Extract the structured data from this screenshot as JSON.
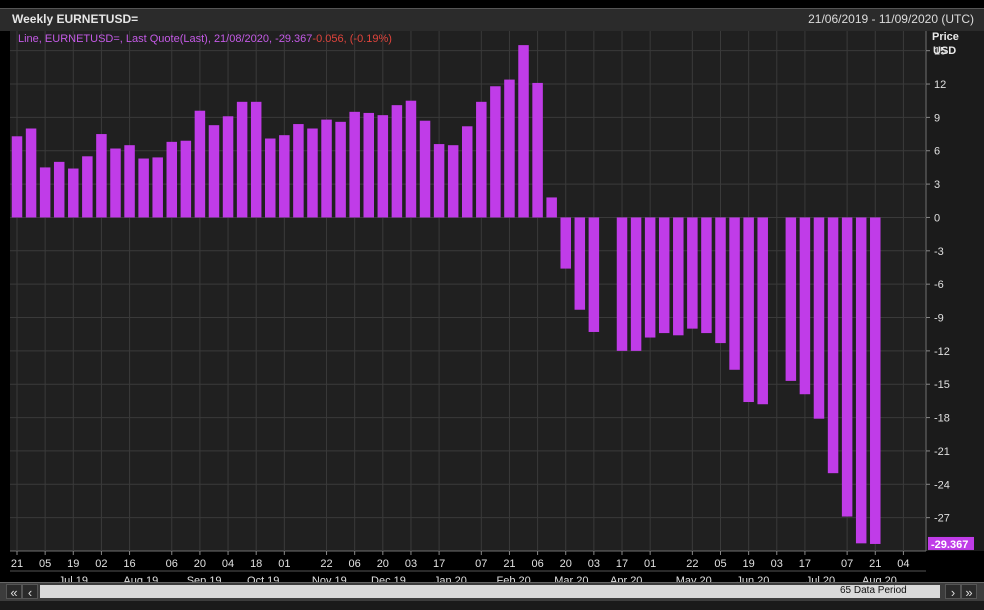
{
  "window": {
    "title": "Weekly EURNETUSD=",
    "date_range": "21/06/2019 - 11/09/2020 (UTC)"
  },
  "legend": {
    "prefix": "Line, EURNETUSD=, Last Quote(Last),  21/08/2020,  -29.367",
    "change": "-0.056",
    "pct": ", (-0.19%)"
  },
  "axis": {
    "price_label": "Price",
    "unit_label": "USD",
    "last_value_label": "-29.367"
  },
  "scroll": {
    "first_label": "«",
    "prev_label": "‹",
    "next_label": "›",
    "last_label": "»",
    "period_label": "65 Data Period"
  },
  "colors": {
    "background": "#202020",
    "grid": "#3a3a3a",
    "bar": "#c03ce8",
    "legend_text": "#c45ae6",
    "negative_text": "#e0443c"
  },
  "chart_data": {
    "type": "bar",
    "title": "Weekly EURNETUSD=",
    "ylabel": "Price USD",
    "ylim": [
      -30,
      16.5
    ],
    "yticks": [
      15,
      12,
      9,
      6,
      3,
      0,
      -3,
      -6,
      -9,
      -12,
      -15,
      -18,
      -21,
      -24,
      -27
    ],
    "series": [
      {
        "name": "EURNETUSD=",
        "values": [
          7.3,
          8.0,
          4.5,
          5.0,
          4.4,
          5.5,
          7.5,
          6.2,
          6.5,
          5.3,
          5.4,
          6.8,
          6.9,
          9.6,
          8.3,
          9.1,
          10.4,
          10.4,
          7.1,
          7.4,
          8.4,
          8.0,
          8.8,
          8.6,
          9.5,
          9.4,
          9.2,
          10.1,
          10.5,
          8.7,
          6.6,
          6.5,
          8.2,
          10.4,
          11.8,
          12.4,
          15.5,
          12.1,
          1.8,
          -4.6,
          -8.3,
          -10.3,
          null,
          -12.0,
          -12.0,
          -10.8,
          -10.4,
          -10.6,
          -10.0,
          -10.4,
          -11.3,
          -13.7,
          -16.6,
          -16.8,
          null,
          -14.7,
          -15.9,
          -18.1,
          -23.0,
          -26.9,
          -29.311,
          -29.367
        ]
      }
    ],
    "x_day_ticks": [
      {
        "i": 0,
        "label": "21"
      },
      {
        "i": 2,
        "label": "05"
      },
      {
        "i": 4,
        "label": "19"
      },
      {
        "i": 6,
        "label": "02"
      },
      {
        "i": 8,
        "label": "16"
      },
      {
        "i": 11,
        "label": "06"
      },
      {
        "i": 13,
        "label": "20"
      },
      {
        "i": 15,
        "label": "04"
      },
      {
        "i": 17,
        "label": "18"
      },
      {
        "i": 19,
        "label": "01"
      },
      {
        "i": 22,
        "label": "22"
      },
      {
        "i": 24,
        "label": "06"
      },
      {
        "i": 26,
        "label": "20"
      },
      {
        "i": 28,
        "label": "03"
      },
      {
        "i": 30,
        "label": "17"
      },
      {
        "i": 33,
        "label": "07"
      },
      {
        "i": 35,
        "label": "21"
      },
      {
        "i": 37,
        "label": "06"
      },
      {
        "i": 39,
        "label": "20"
      },
      {
        "i": 41,
        "label": "03"
      },
      {
        "i": 43,
        "label": "17"
      },
      {
        "i": 45,
        "label": "01"
      },
      {
        "i": 48,
        "label": "22"
      },
      {
        "i": 50,
        "label": "05"
      },
      {
        "i": 52,
        "label": "19"
      },
      {
        "i": 54,
        "label": "03"
      },
      {
        "i": 56,
        "label": "17"
      },
      {
        "i": 59,
        "label": "07"
      },
      {
        "i": 61,
        "label": "21"
      },
      {
        "i": 63,
        "label": "04"
      }
    ],
    "x_month_ticks": [
      {
        "i": 4,
        "label": "Jul 19"
      },
      {
        "i": 8.8,
        "label": "Aug 19"
      },
      {
        "i": 13.3,
        "label": "Sep 19"
      },
      {
        "i": 17.5,
        "label": "Oct 19"
      },
      {
        "i": 22.2,
        "label": "Nov 19"
      },
      {
        "i": 26.4,
        "label": "Dec 19"
      },
      {
        "i": 30.8,
        "label": "Jan 20"
      },
      {
        "i": 35.3,
        "label": "Feb 20"
      },
      {
        "i": 39.4,
        "label": "Mar 20"
      },
      {
        "i": 43.3,
        "label": "Apr 20"
      },
      {
        "i": 48.1,
        "label": "May 20"
      },
      {
        "i": 52.3,
        "label": "Jun 20"
      },
      {
        "i": 57.1,
        "label": "Jul 20"
      },
      {
        "i": 61.3,
        "label": "Aug 20"
      }
    ]
  }
}
